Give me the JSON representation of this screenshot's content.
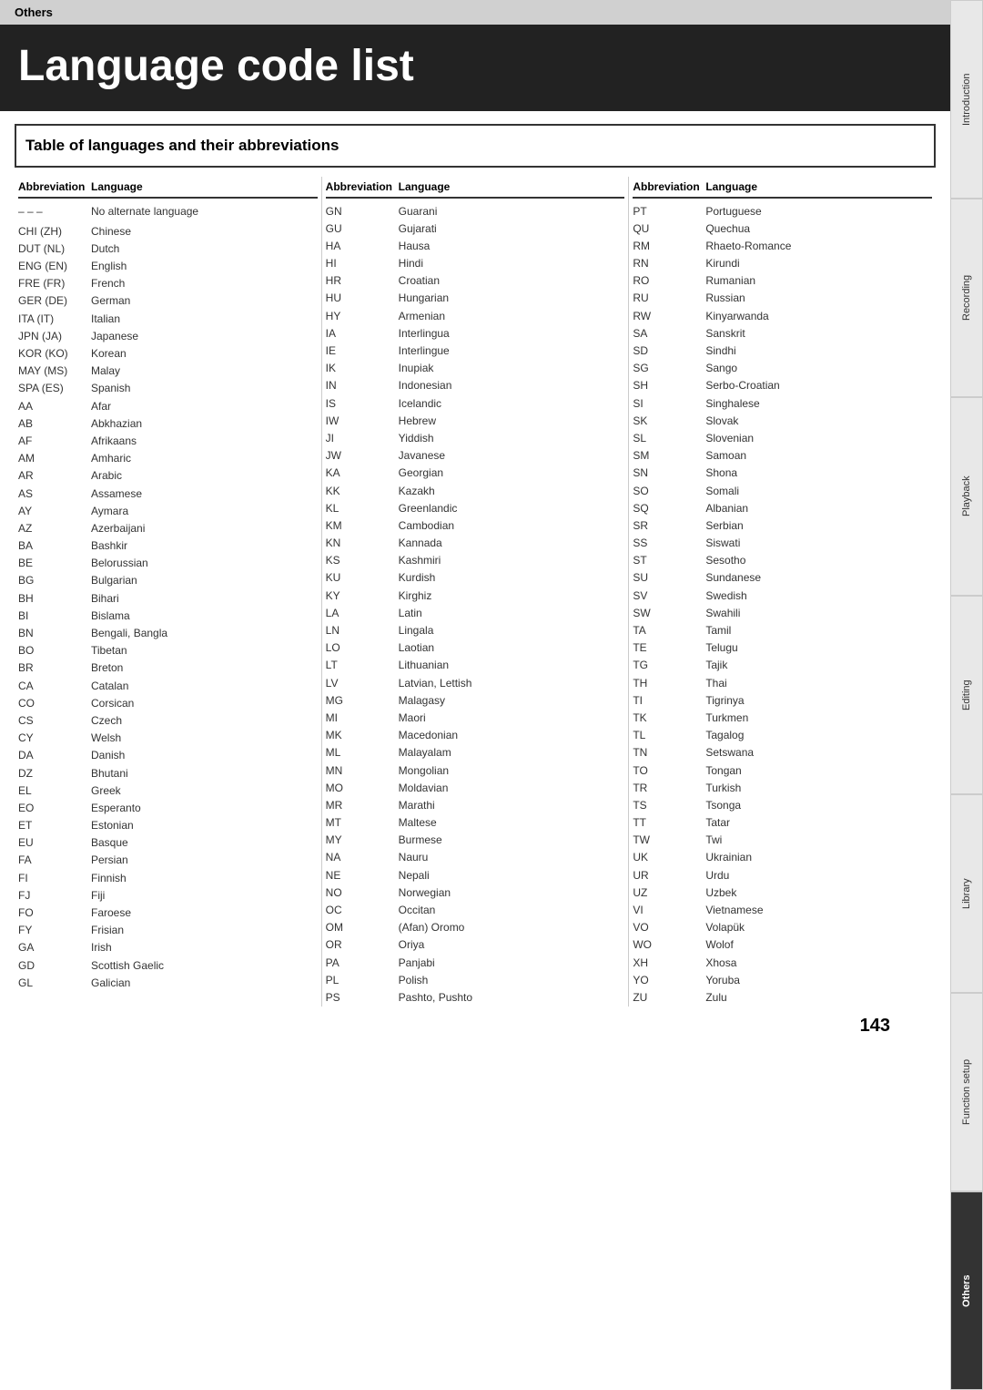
{
  "topBar": {
    "label": "Others"
  },
  "title": "Language code list",
  "tableTitle": "Table of languages and their abbreviations",
  "pageNumber": "143",
  "sidebar": {
    "tabs": [
      {
        "label": "Introduction",
        "active": false
      },
      {
        "label": "Recording",
        "active": false
      },
      {
        "label": "Playback",
        "active": false
      },
      {
        "label": "Editing",
        "active": false
      },
      {
        "label": "Library",
        "active": false
      },
      {
        "label": "Function setup",
        "active": false
      },
      {
        "label": "Others",
        "active": true
      }
    ]
  },
  "columns": [
    {
      "header": {
        "abbr": "Abbreviation",
        "lang": "Language"
      },
      "rows": [
        {
          "abbr": "– – –",
          "lang": "No alternate language"
        },
        {
          "abbr": "",
          "lang": ""
        },
        {
          "abbr": "CHI (ZH)",
          "lang": "Chinese"
        },
        {
          "abbr": "DUT (NL)",
          "lang": "Dutch"
        },
        {
          "abbr": "ENG (EN)",
          "lang": "English"
        },
        {
          "abbr": "FRE (FR)",
          "lang": "French"
        },
        {
          "abbr": "GER (DE)",
          "lang": "German"
        },
        {
          "abbr": "ITA (IT)",
          "lang": "Italian"
        },
        {
          "abbr": "JPN (JA)",
          "lang": "Japanese"
        },
        {
          "abbr": "KOR (KO)",
          "lang": "Korean"
        },
        {
          "abbr": "MAY (MS)",
          "lang": "Malay"
        },
        {
          "abbr": "SPA (ES)",
          "lang": "Spanish"
        },
        {
          "abbr": "AA",
          "lang": "Afar"
        },
        {
          "abbr": "AB",
          "lang": "Abkhazian"
        },
        {
          "abbr": "AF",
          "lang": "Afrikaans"
        },
        {
          "abbr": "AM",
          "lang": "Amharic"
        },
        {
          "abbr": "AR",
          "lang": "Arabic"
        },
        {
          "abbr": "AS",
          "lang": "Assamese"
        },
        {
          "abbr": "AY",
          "lang": "Aymara"
        },
        {
          "abbr": "AZ",
          "lang": "Azerbaijani"
        },
        {
          "abbr": "BA",
          "lang": "Bashkir"
        },
        {
          "abbr": "BE",
          "lang": "Belorussian"
        },
        {
          "abbr": "BG",
          "lang": "Bulgarian"
        },
        {
          "abbr": "BH",
          "lang": "Bihari"
        },
        {
          "abbr": "BI",
          "lang": "Bislama"
        },
        {
          "abbr": "BN",
          "lang": "Bengali, Bangla"
        },
        {
          "abbr": "BO",
          "lang": "Tibetan"
        },
        {
          "abbr": "BR",
          "lang": "Breton"
        },
        {
          "abbr": "CA",
          "lang": "Catalan"
        },
        {
          "abbr": "CO",
          "lang": "Corsican"
        },
        {
          "abbr": "CS",
          "lang": "Czech"
        },
        {
          "abbr": "CY",
          "lang": "Welsh"
        },
        {
          "abbr": "DA",
          "lang": "Danish"
        },
        {
          "abbr": "DZ",
          "lang": "Bhutani"
        },
        {
          "abbr": "EL",
          "lang": "Greek"
        },
        {
          "abbr": "EO",
          "lang": "Esperanto"
        },
        {
          "abbr": "ET",
          "lang": "Estonian"
        },
        {
          "abbr": "EU",
          "lang": "Basque"
        },
        {
          "abbr": "FA",
          "lang": "Persian"
        },
        {
          "abbr": "FI",
          "lang": "Finnish"
        },
        {
          "abbr": "FJ",
          "lang": "Fiji"
        },
        {
          "abbr": "FO",
          "lang": "Faroese"
        },
        {
          "abbr": "FY",
          "lang": "Frisian"
        },
        {
          "abbr": "GA",
          "lang": "Irish"
        },
        {
          "abbr": "GD",
          "lang": "Scottish Gaelic"
        },
        {
          "abbr": "GL",
          "lang": "Galician"
        }
      ]
    },
    {
      "header": {
        "abbr": "Abbreviation",
        "lang": "Language"
      },
      "rows": [
        {
          "abbr": "GN",
          "lang": "Guarani"
        },
        {
          "abbr": "GU",
          "lang": "Gujarati"
        },
        {
          "abbr": "HA",
          "lang": "Hausa"
        },
        {
          "abbr": "HI",
          "lang": "Hindi"
        },
        {
          "abbr": "HR",
          "lang": "Croatian"
        },
        {
          "abbr": "HU",
          "lang": "Hungarian"
        },
        {
          "abbr": "HY",
          "lang": "Armenian"
        },
        {
          "abbr": "IA",
          "lang": "Interlingua"
        },
        {
          "abbr": "IE",
          "lang": "Interlingue"
        },
        {
          "abbr": "IK",
          "lang": "Inupiak"
        },
        {
          "abbr": "IN",
          "lang": "Indonesian"
        },
        {
          "abbr": "IS",
          "lang": "Icelandic"
        },
        {
          "abbr": "IW",
          "lang": "Hebrew"
        },
        {
          "abbr": "JI",
          "lang": "Yiddish"
        },
        {
          "abbr": "JW",
          "lang": "Javanese"
        },
        {
          "abbr": "KA",
          "lang": "Georgian"
        },
        {
          "abbr": "KK",
          "lang": "Kazakh"
        },
        {
          "abbr": "KL",
          "lang": "Greenlandic"
        },
        {
          "abbr": "KM",
          "lang": "Cambodian"
        },
        {
          "abbr": "KN",
          "lang": "Kannada"
        },
        {
          "abbr": "KS",
          "lang": "Kashmiri"
        },
        {
          "abbr": "KU",
          "lang": "Kurdish"
        },
        {
          "abbr": "KY",
          "lang": "Kirghiz"
        },
        {
          "abbr": "LA",
          "lang": "Latin"
        },
        {
          "abbr": "LN",
          "lang": "Lingala"
        },
        {
          "abbr": "LO",
          "lang": "Laotian"
        },
        {
          "abbr": "LT",
          "lang": "Lithuanian"
        },
        {
          "abbr": "LV",
          "lang": "Latvian, Lettish"
        },
        {
          "abbr": "MG",
          "lang": "Malagasy"
        },
        {
          "abbr": "MI",
          "lang": "Maori"
        },
        {
          "abbr": "MK",
          "lang": "Macedonian"
        },
        {
          "abbr": "ML",
          "lang": "Malayalam"
        },
        {
          "abbr": "MN",
          "lang": "Mongolian"
        },
        {
          "abbr": "MO",
          "lang": "Moldavian"
        },
        {
          "abbr": "MR",
          "lang": "Marathi"
        },
        {
          "abbr": "MT",
          "lang": "Maltese"
        },
        {
          "abbr": "MY",
          "lang": "Burmese"
        },
        {
          "abbr": "NA",
          "lang": "Nauru"
        },
        {
          "abbr": "NE",
          "lang": "Nepali"
        },
        {
          "abbr": "NO",
          "lang": "Norwegian"
        },
        {
          "abbr": "OC",
          "lang": "Occitan"
        },
        {
          "abbr": "OM",
          "lang": "(Afan) Oromo"
        },
        {
          "abbr": "OR",
          "lang": "Oriya"
        },
        {
          "abbr": "PA",
          "lang": "Panjabi"
        },
        {
          "abbr": "PL",
          "lang": "Polish"
        },
        {
          "abbr": "PS",
          "lang": "Pashto, Pushto"
        }
      ]
    },
    {
      "header": {
        "abbr": "Abbreviation",
        "lang": "Language"
      },
      "rows": [
        {
          "abbr": "PT",
          "lang": "Portuguese"
        },
        {
          "abbr": "QU",
          "lang": "Quechua"
        },
        {
          "abbr": "RM",
          "lang": "Rhaeto-Romance"
        },
        {
          "abbr": "RN",
          "lang": "Kirundi"
        },
        {
          "abbr": "RO",
          "lang": "Rumanian"
        },
        {
          "abbr": "RU",
          "lang": "Russian"
        },
        {
          "abbr": "RW",
          "lang": "Kinyarwanda"
        },
        {
          "abbr": "SA",
          "lang": "Sanskrit"
        },
        {
          "abbr": "SD",
          "lang": "Sindhi"
        },
        {
          "abbr": "SG",
          "lang": "Sango"
        },
        {
          "abbr": "SH",
          "lang": "Serbo-Croatian"
        },
        {
          "abbr": "SI",
          "lang": "Singhalese"
        },
        {
          "abbr": "SK",
          "lang": "Slovak"
        },
        {
          "abbr": "SL",
          "lang": "Slovenian"
        },
        {
          "abbr": "SM",
          "lang": "Samoan"
        },
        {
          "abbr": "SN",
          "lang": "Shona"
        },
        {
          "abbr": "SO",
          "lang": "Somali"
        },
        {
          "abbr": "SQ",
          "lang": "Albanian"
        },
        {
          "abbr": "SR",
          "lang": "Serbian"
        },
        {
          "abbr": "SS",
          "lang": "Siswati"
        },
        {
          "abbr": "ST",
          "lang": "Sesotho"
        },
        {
          "abbr": "SU",
          "lang": "Sundanese"
        },
        {
          "abbr": "SV",
          "lang": "Swedish"
        },
        {
          "abbr": "SW",
          "lang": "Swahili"
        },
        {
          "abbr": "TA",
          "lang": "Tamil"
        },
        {
          "abbr": "TE",
          "lang": "Telugu"
        },
        {
          "abbr": "TG",
          "lang": "Tajik"
        },
        {
          "abbr": "TH",
          "lang": "Thai"
        },
        {
          "abbr": "TI",
          "lang": "Tigrinya"
        },
        {
          "abbr": "TK",
          "lang": "Turkmen"
        },
        {
          "abbr": "TL",
          "lang": "Tagalog"
        },
        {
          "abbr": "TN",
          "lang": "Setswana"
        },
        {
          "abbr": "TO",
          "lang": "Tongan"
        },
        {
          "abbr": "TR",
          "lang": "Turkish"
        },
        {
          "abbr": "TS",
          "lang": "Tsonga"
        },
        {
          "abbr": "TT",
          "lang": "Tatar"
        },
        {
          "abbr": "TW",
          "lang": "Twi"
        },
        {
          "abbr": "UK",
          "lang": "Ukrainian"
        },
        {
          "abbr": "UR",
          "lang": "Urdu"
        },
        {
          "abbr": "UZ",
          "lang": "Uzbek"
        },
        {
          "abbr": "VI",
          "lang": "Vietnamese"
        },
        {
          "abbr": "VO",
          "lang": "Volapük"
        },
        {
          "abbr": "WO",
          "lang": "Wolof"
        },
        {
          "abbr": "XH",
          "lang": "Xhosa"
        },
        {
          "abbr": "YO",
          "lang": "Yoruba"
        },
        {
          "abbr": "ZU",
          "lang": "Zulu"
        }
      ]
    }
  ]
}
